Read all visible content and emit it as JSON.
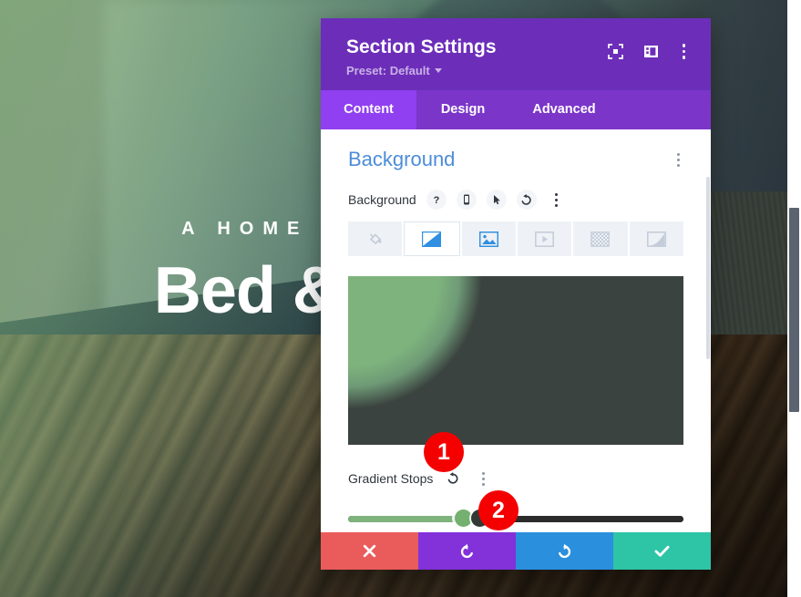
{
  "background_page": {
    "hero": {
      "eyebrow": "A HOME AWAY FROM HOME",
      "title": "Bed & Breakfast"
    }
  },
  "modal": {
    "title": "Section Settings",
    "preset_label": "Preset: Default",
    "header_icons": [
      {
        "name": "focus-icon",
        "title": "Focus"
      },
      {
        "name": "layout-panel-icon",
        "title": "Panel Layout"
      },
      {
        "name": "more-options-icon",
        "title": "More Options"
      }
    ],
    "tabs": [
      {
        "label": "Content",
        "active": true
      },
      {
        "label": "Design",
        "active": false
      },
      {
        "label": "Advanced",
        "active": false
      }
    ],
    "section": {
      "title": "Background",
      "field_label": "Background",
      "field_icons": [
        {
          "name": "help-icon",
          "glyph": "?"
        },
        {
          "name": "responsive-mobile-icon",
          "glyph": "mobile"
        },
        {
          "name": "hover-cursor-icon",
          "glyph": "cursor"
        },
        {
          "name": "reset-icon",
          "glyph": "undo"
        },
        {
          "name": "more-options-icon",
          "glyph": "dots"
        }
      ],
      "background_types": [
        {
          "name": "background-color",
          "label": "Background Color",
          "active": false
        },
        {
          "name": "background-gradient",
          "label": "Background Gradient",
          "active": true
        },
        {
          "name": "background-image",
          "label": "Background Image",
          "active": false
        },
        {
          "name": "background-video",
          "label": "Background Video",
          "active": false
        },
        {
          "name": "background-pattern",
          "label": "Background Pattern",
          "active": false
        },
        {
          "name": "background-mask",
          "label": "Background Mask",
          "active": false
        }
      ],
      "gradient_preview": {
        "start_color": "#7eb37d",
        "end_color": "#3b4340",
        "type": "radial"
      },
      "gradient_stops": {
        "label": "Gradient Stops",
        "stops": [
          {
            "color": "#7eb37d",
            "position_pct": 32
          },
          {
            "color": "#333a35",
            "position_pct": 37
          }
        ]
      }
    },
    "footer_buttons": [
      {
        "name": "cancel-button",
        "glyph": "✖",
        "color": "#ea5b5b"
      },
      {
        "name": "undo-button",
        "glyph": "undo",
        "color": "#8331d8"
      },
      {
        "name": "redo-button",
        "glyph": "redo",
        "color": "#2a8fdd"
      },
      {
        "name": "save-button",
        "glyph": "✔",
        "color": "#2ec4a6"
      }
    ]
  },
  "annotations": [
    {
      "name": "annotation-badge-1",
      "label": "1"
    },
    {
      "name": "annotation-badge-2",
      "label": "2"
    }
  ]
}
